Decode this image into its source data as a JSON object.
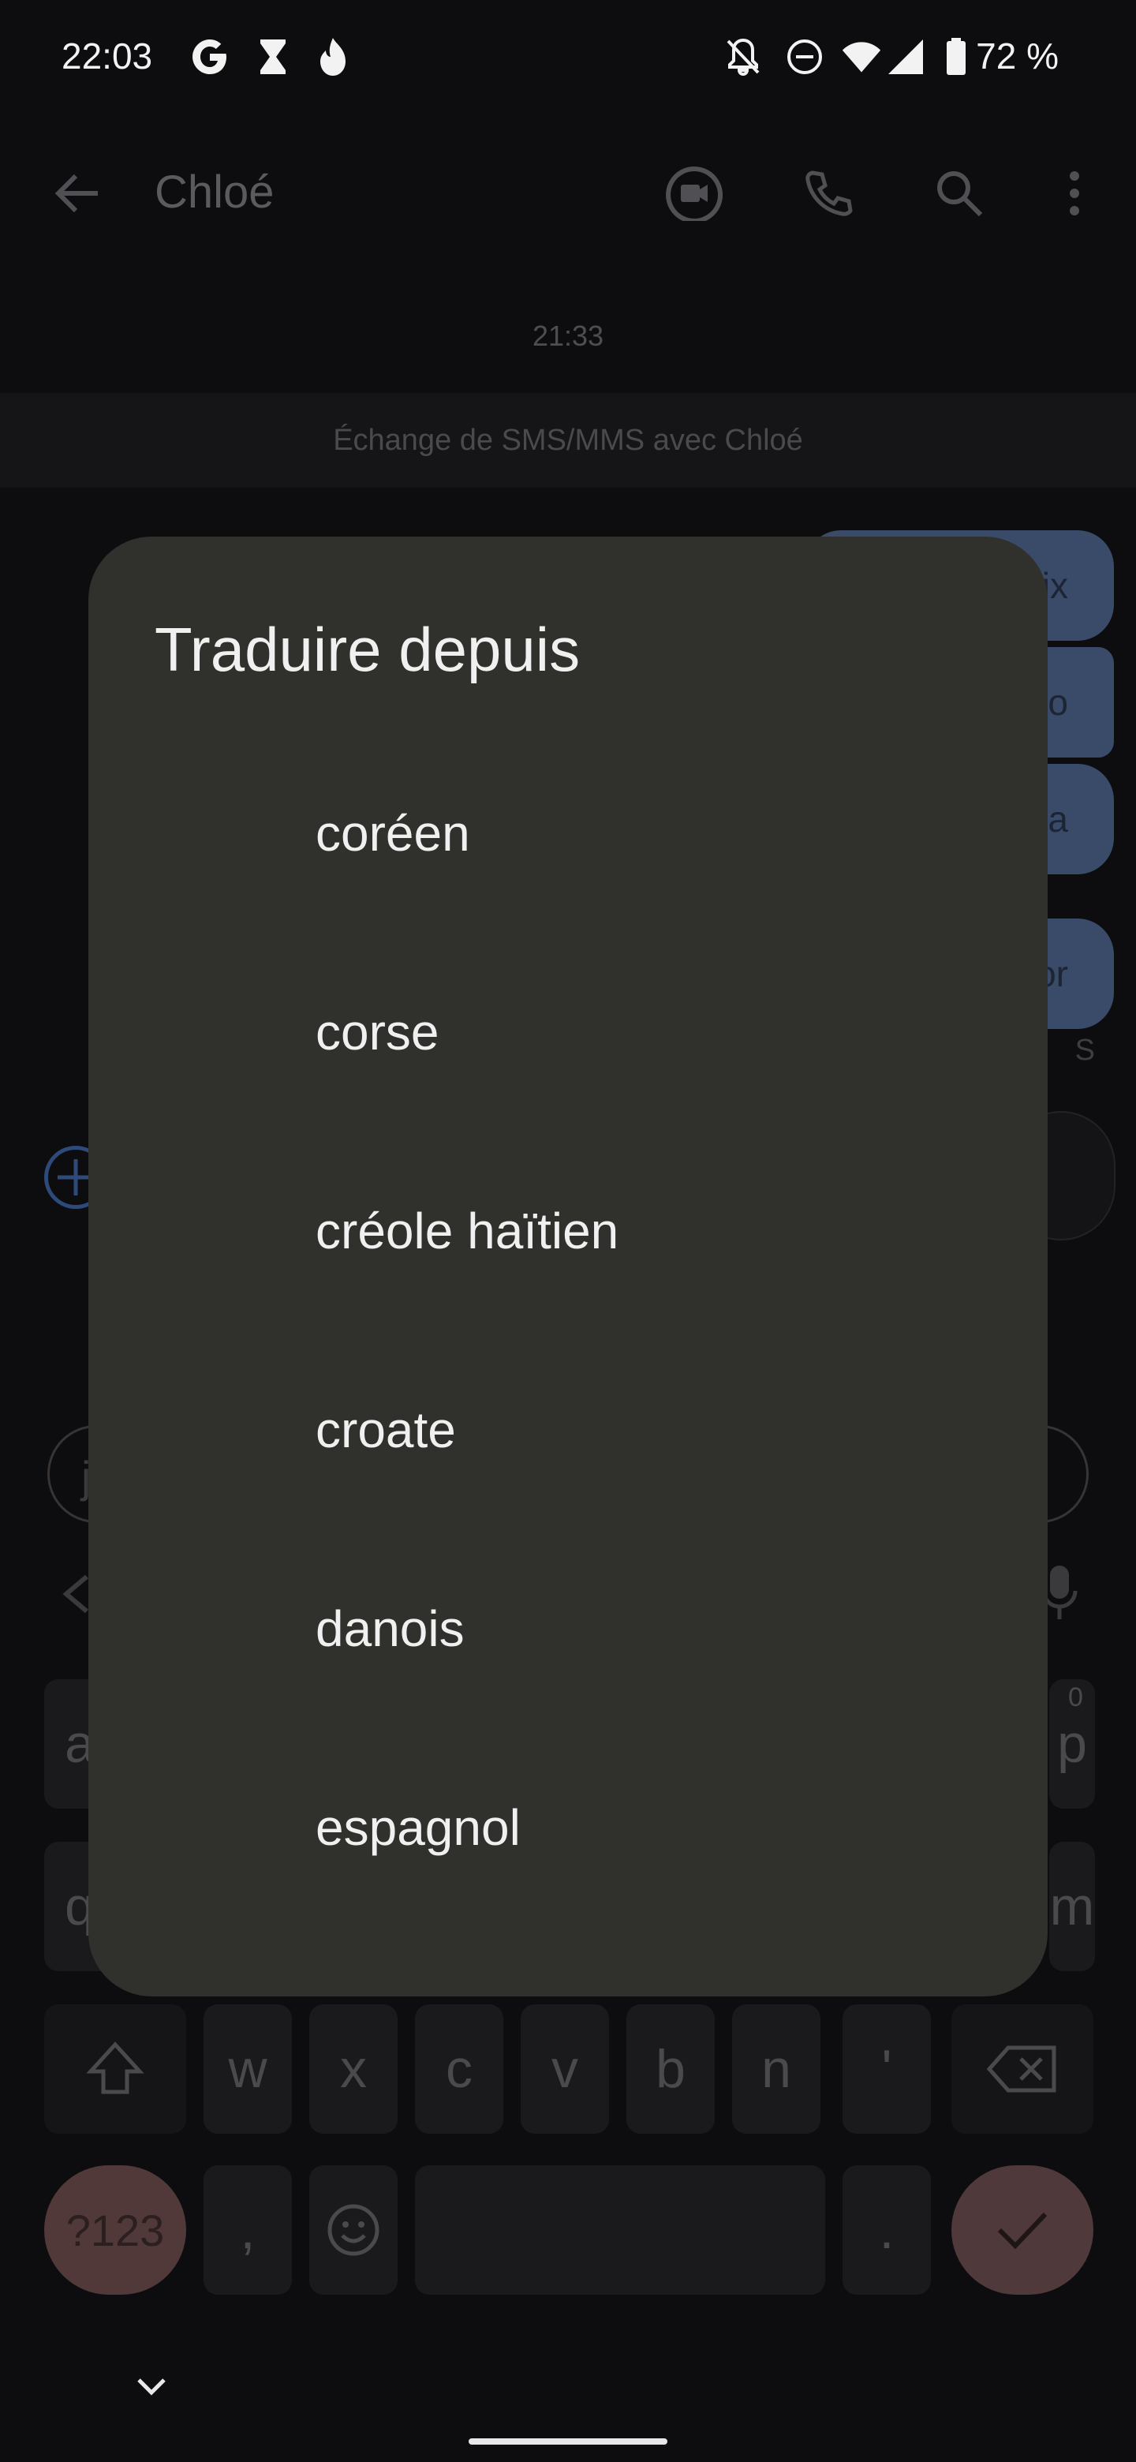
{
  "status_bar": {
    "time": "22:03",
    "battery": "72 %",
    "left_icons": [
      "google-icon",
      "hourglass-icon",
      "flame-icon"
    ],
    "right_icons": [
      "bell-off-icon",
      "do-not-disturb-icon",
      "wifi-icon",
      "signal-icon",
      "battery-icon"
    ]
  },
  "toolbar": {
    "title": "Chloé"
  },
  "conversation": {
    "timestamp": "21:33",
    "sms_banner": "Échange de SMS/MMS avec Chloé",
    "bubbles": [
      {
        "text": "ix"
      },
      {
        "text": "o"
      },
      {
        "text": "a"
      },
      {
        "text": "or"
      }
    ],
    "bubble_status": "S",
    "suggestion_chip": "j"
  },
  "dialog": {
    "title": "Traduire depuis",
    "options": [
      "coréen",
      "corse",
      "créole haïtien",
      "croate",
      "danois",
      "espagnol"
    ]
  },
  "keyboard": {
    "row1_visible": [
      "a",
      "p"
    ],
    "row1_superscript": "0",
    "row2_visible": [
      "q",
      "m"
    ],
    "row3": [
      "w",
      "x",
      "c",
      "v",
      "b",
      "n",
      "'"
    ],
    "symbols_key": "?123",
    "comma_key": ",",
    "period_key": "."
  },
  "colors": {
    "background": "#0d0c0e",
    "dialog": "#30302c",
    "accent_bubble": "#3a4b69",
    "symbols_key": "#51393a"
  }
}
